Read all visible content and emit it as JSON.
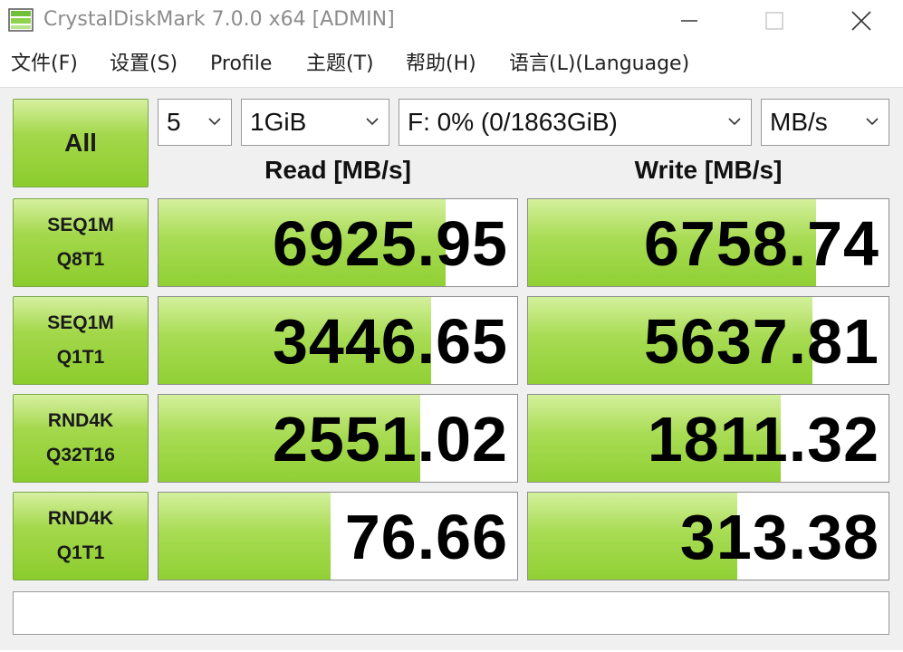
{
  "window": {
    "title": "CrystalDiskMark 7.0.0 x64 [ADMIN]",
    "icon": "crystaldiskmark-app-icon",
    "controls": [
      "minimize-icon",
      "maximize-icon",
      "close-icon"
    ]
  },
  "menu": {
    "items": [
      "文件(F)",
      "设置(S)",
      "Profile",
      "主题(T)",
      "帮助(H)",
      "语言(L)(Language)"
    ]
  },
  "toolbar": {
    "all_label": "All",
    "count_value": "5",
    "size_value": "1GiB",
    "drive_value": "F: 0% (0/1863GiB)",
    "unit_value": "MB/s"
  },
  "headers": {
    "read": "Read [MB/s]",
    "write": "Write [MB/s]"
  },
  "tests": [
    {
      "line1": "SEQ1M",
      "line2": "Q8T1",
      "read": "6925.95",
      "write": "6758.74",
      "read_fill_pct": 80,
      "write_fill_pct": 80
    },
    {
      "line1": "SEQ1M",
      "line2": "Q1T1",
      "read": "3446.65",
      "write": "5637.81",
      "read_fill_pct": 76,
      "write_fill_pct": 79
    },
    {
      "line1": "RND4K",
      "line2": "Q32T16",
      "read": "2551.02",
      "write": "1811.32",
      "read_fill_pct": 73,
      "write_fill_pct": 70
    },
    {
      "line1": "RND4K",
      "line2": "Q1T1",
      "read": "76.66",
      "write": "313.38",
      "read_fill_pct": 48,
      "write_fill_pct": 58
    }
  ],
  "comment": "",
  "colors": {
    "accent_green": "#a4d84c",
    "border_green": "#7aa84a",
    "panel_bg": "#f0f0f0"
  }
}
